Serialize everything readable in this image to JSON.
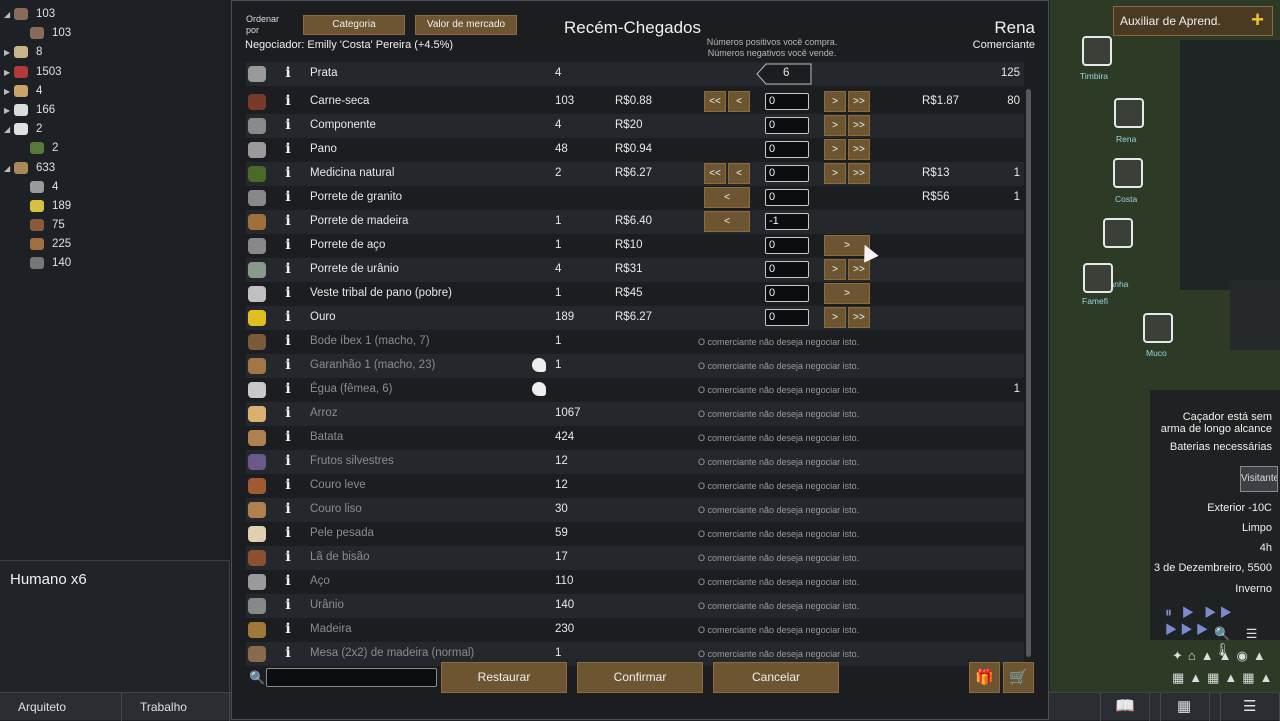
{
  "left_panel": {
    "resources": [
      {
        "expand": "◢",
        "value": "103"
      },
      {
        "expand": "",
        "value": "103"
      },
      {
        "expand": "▶",
        "value": "8"
      },
      {
        "expand": "▶",
        "value": "1503"
      },
      {
        "expand": "▶",
        "value": "4"
      },
      {
        "expand": "▶",
        "value": "166"
      },
      {
        "expand": "◢",
        "value": "2"
      },
      {
        "expand": "",
        "value": "2"
      },
      {
        "expand": "◢",
        "value": "633"
      },
      {
        "expand": "",
        "value": "4"
      },
      {
        "expand": "",
        "value": "189"
      },
      {
        "expand": "",
        "value": "75"
      },
      {
        "expand": "",
        "value": "225"
      },
      {
        "expand": "",
        "value": "140"
      }
    ],
    "colony_label": "Humano x6"
  },
  "bottom_bar": {
    "architect": "Arquiteto",
    "work": "Trabalho"
  },
  "trade": {
    "sort_by_label": "Ordenar por",
    "sort_category": "Categoria",
    "sort_market": "Valor de mercado",
    "title": "Recém-Chegados",
    "negotiator": "Negociador: Emilly 'Costa' Pereira (+4.5%)",
    "hint_line1": "Números positivos você compra.",
    "hint_line2": "Números negativos você vende.",
    "trader_name": "Rena",
    "trader_kind": "Comerciante",
    "silver": {
      "name": "Prata",
      "colony_count": "4",
      "transfer": "6",
      "trader_count": "125"
    },
    "rows": [
      {
        "name": "Carne-seca",
        "count": "103",
        "price": "R$0.88",
        "qty": "0",
        "left2": "<<",
        "left1": "<",
        "right1": ">",
        "right2": ">>",
        "tprice": "R$1.87",
        "tcount": "80",
        "dim": false
      },
      {
        "name": "Componente",
        "count": "4",
        "price": "R$20",
        "qty": "0",
        "left2": "",
        "left1": "",
        "right1": ">",
        "right2": ">>",
        "tprice": "",
        "tcount": "",
        "dim": false
      },
      {
        "name": "Pano",
        "count": "48",
        "price": "R$0.94",
        "qty": "0",
        "left2": "",
        "left1": "",
        "right1": ">",
        "right2": ">>",
        "tprice": "",
        "tcount": "",
        "dim": false
      },
      {
        "name": "Medicina natural",
        "count": "2",
        "price": "R$6.27",
        "qty": "0",
        "left2": "<<",
        "left1": "<",
        "right1": ">",
        "right2": ">>",
        "tprice": "R$13",
        "tcount": "1",
        "dim": false
      },
      {
        "name": "Porrete de granito",
        "count": "",
        "price": "",
        "qty": "0",
        "left2": "",
        "left1": "<",
        "right1": "",
        "right2": "",
        "tprice": "R$56",
        "tcount": "1",
        "dim": false
      },
      {
        "name": "Porrete de madeira",
        "count": "1",
        "price": "R$6.40",
        "qty": "-1",
        "left2": "",
        "left1": "<",
        "right1": "",
        "right2": "",
        "tprice": "",
        "tcount": "",
        "dim": false
      },
      {
        "name": "Porrete de aço",
        "count": "1",
        "price": "R$10",
        "qty": "0",
        "left2": "",
        "left1": "",
        "right1": ">",
        "right2": "",
        "tprice": "",
        "tcount": "",
        "dim": false
      },
      {
        "name": "Porrete de urânio",
        "count": "4",
        "price": "R$31",
        "qty": "0",
        "left2": "",
        "left1": "",
        "right1": ">",
        "right2": ">>",
        "tprice": "",
        "tcount": "",
        "dim": false
      },
      {
        "name": "Veste tribal de pano (pobre)",
        "count": "1",
        "price": "R$45",
        "qty": "0",
        "left2": "",
        "left1": "",
        "right1": ">",
        "right2": "",
        "tprice": "",
        "tcount": "",
        "dim": false
      },
      {
        "name": "Ouro",
        "count": "189",
        "price": "R$6.27",
        "qty": "0",
        "left2": "",
        "left1": "",
        "right1": ">",
        "right2": ">>",
        "tprice": "",
        "tcount": "",
        "dim": false
      }
    ],
    "no_trade_msg": "O comerciante não deseja negociar isto.",
    "dim_rows": [
      {
        "name": "Bode íbex 1 (macho, 7)",
        "count": "1",
        "tcount": "",
        "gender": false
      },
      {
        "name": "Garanhão 1 (macho, 23)",
        "count": "1",
        "tcount": "",
        "gender": true
      },
      {
        "name": "Égua (fêmea, 6)",
        "count": "",
        "tcount": "1",
        "gender": true
      },
      {
        "name": "Arroz",
        "count": "1067",
        "tcount": "",
        "gender": false
      },
      {
        "name": "Batata",
        "count": "424",
        "tcount": "",
        "gender": false
      },
      {
        "name": "Frutos silvestres",
        "count": "12",
        "tcount": "",
        "gender": false
      },
      {
        "name": "Couro leve",
        "count": "12",
        "tcount": "",
        "gender": false
      },
      {
        "name": "Couro liso",
        "count": "30",
        "tcount": "",
        "gender": false
      },
      {
        "name": "Pele pesada",
        "count": "59",
        "tcount": "",
        "gender": false
      },
      {
        "name": "Lã de bisão",
        "count": "17",
        "tcount": "",
        "gender": false
      },
      {
        "name": "Aço",
        "count": "110",
        "tcount": "",
        "gender": false
      },
      {
        "name": "Urânio",
        "count": "140",
        "tcount": "",
        "gender": false
      },
      {
        "name": "Madeira",
        "count": "230",
        "tcount": "",
        "gender": false
      },
      {
        "name": "Mesa (2x2) de madeira (normal)",
        "count": "1",
        "tcount": "",
        "gender": false
      }
    ],
    "btn_reset": "Restaurar",
    "btn_confirm": "Confirmar",
    "btn_cancel": "Cancelar"
  },
  "map": {
    "learning_helper": "Auxiliar de Aprend.",
    "pawns": [
      "Timbira",
      "Rena",
      "Costa",
      "Aranha",
      "Famefi",
      "Muco"
    ],
    "alert1_line1": "Caçador está sem",
    "alert1_line2": "arma de longo alcance",
    "alert2": "Baterias necessárias",
    "visitors": "Visitantes",
    "temperature": "Exterior -10C",
    "weather": "Limpo",
    "time": "4h",
    "date": "3 de Dezembreiro, 5500",
    "season": "Inverno"
  }
}
